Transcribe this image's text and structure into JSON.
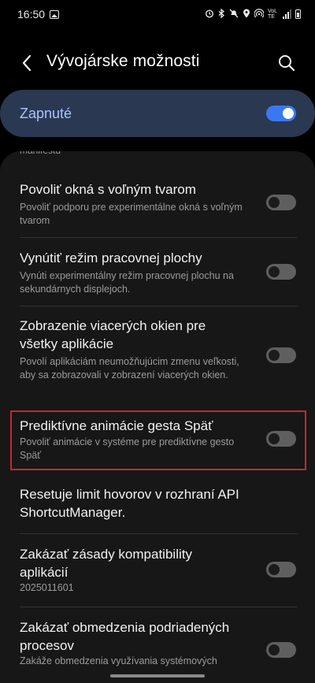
{
  "status_bar": {
    "time": "16:50",
    "icons": [
      "image-icon",
      "alarm-icon",
      "bluetooth-icon",
      "silent-icon",
      "location-icon",
      "hotspot-icon",
      "volte-icon",
      "signal-icon",
      "battery-icon"
    ],
    "volte_label": "VoLTE"
  },
  "header": {
    "title": "Vývojárske možnosti",
    "back_icon": "chevron-left-icon",
    "search_icon": "search-icon"
  },
  "master": {
    "label": "Zapnuté",
    "checked": true,
    "accent": "#3a78f0"
  },
  "list": {
    "cut_text": "manifestu",
    "items": [
      {
        "title": "Povoliť okná s voľným tvarom",
        "desc": "Povoliť podporu pre experimentálne okná s voľným tvarom",
        "checked": false
      },
      {
        "title": "Vynútiť režim pracovnej plochy",
        "desc": "Vynúti experimentálny režim pracovnej plochu na sekundárnych displejoch.",
        "checked": false
      },
      {
        "title": "Zobrazenie viacerých okien pre všetky aplikácie",
        "desc": "Povolí aplikáciám neumožňujúcim zmenu veľkosti, aby sa zobrazovali v zobrazení viacerých okien.",
        "checked": false
      },
      {
        "title": "Prediktívne animácie gesta Späť",
        "desc": "Povoliť animácie v systéme pre prediktívne gesto Späť",
        "checked": false,
        "highlighted": true,
        "highlight_color": "#c8262c"
      },
      {
        "title": "Resetuje limit hovorov v rozhraní API ShortcutManager."
      },
      {
        "title": "Zakázať zásady kompatibility aplikácií",
        "desc": "2025011601",
        "checked": false
      },
      {
        "title": "Zakázať obmedzenia podriadených procesov",
        "desc": "Zakáže obmedzenia využívania systémových",
        "checked": false
      }
    ]
  }
}
